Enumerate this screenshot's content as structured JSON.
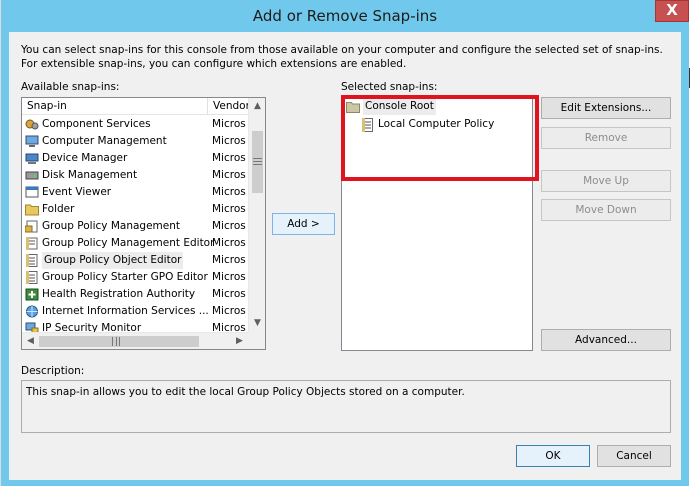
{
  "window": {
    "title": "Add or Remove Snap-ins",
    "close_glyph": "X"
  },
  "intro": "You can select snap-ins for this console from those available on your computer and configure the selected set of snap-ins. For extensible snap-ins, you can configure which extensions are enabled.",
  "available": {
    "label": "Available snap-ins:",
    "col_snapin": "Snap-in",
    "col_vendor": "Vendor",
    "items": [
      {
        "name": "Component Services",
        "vendor": "Microso",
        "icon": "component-services-icon"
      },
      {
        "name": "Computer Management",
        "vendor": "Microso",
        "icon": "computer-management-icon"
      },
      {
        "name": "Device Manager",
        "vendor": "Microso",
        "icon": "device-manager-icon"
      },
      {
        "name": "Disk Management",
        "vendor": "Microso",
        "icon": "disk-management-icon"
      },
      {
        "name": "Event Viewer",
        "vendor": "Microso",
        "icon": "event-viewer-icon"
      },
      {
        "name": "Folder",
        "vendor": "Microso",
        "icon": "folder-icon"
      },
      {
        "name": "Group Policy Management",
        "vendor": "Microso",
        "icon": "group-policy-management-icon"
      },
      {
        "name": "Group Policy Management Editor",
        "vendor": "Microso",
        "icon": "group-policy-editor-icon"
      },
      {
        "name": "Group Policy Object Editor",
        "vendor": "Microso",
        "icon": "policy-document-icon"
      },
      {
        "name": "Group Policy Starter GPO Editor",
        "vendor": "Microso",
        "icon": "policy-document-icon"
      },
      {
        "name": "Health Registration Authority",
        "vendor": "Microso",
        "icon": "health-registration-icon"
      },
      {
        "name": "Internet Information Services ...",
        "vendor": "Microso",
        "icon": "iis-globe-icon"
      },
      {
        "name": "IP Security Monitor",
        "vendor": "Microso",
        "icon": "ip-security-icon"
      }
    ],
    "selected_index": 8
  },
  "add_button": "Add >",
  "selected": {
    "label": "Selected snap-ins:",
    "root": "Console Root",
    "child": "Local Computer Policy"
  },
  "buttons": {
    "edit_extensions": "Edit Extensions...",
    "remove": "Remove",
    "move_up": "Move Up",
    "move_down": "Move Down",
    "advanced": "Advanced...",
    "ok": "OK",
    "cancel": "Cancel"
  },
  "description": {
    "label": "Description:",
    "text": "This snap-in allows you to edit the local Group Policy Objects stored on a computer."
  },
  "colors": {
    "titlebar": "#70c9ec",
    "highlight_box": "#e0141e",
    "selection": "#ececec"
  }
}
